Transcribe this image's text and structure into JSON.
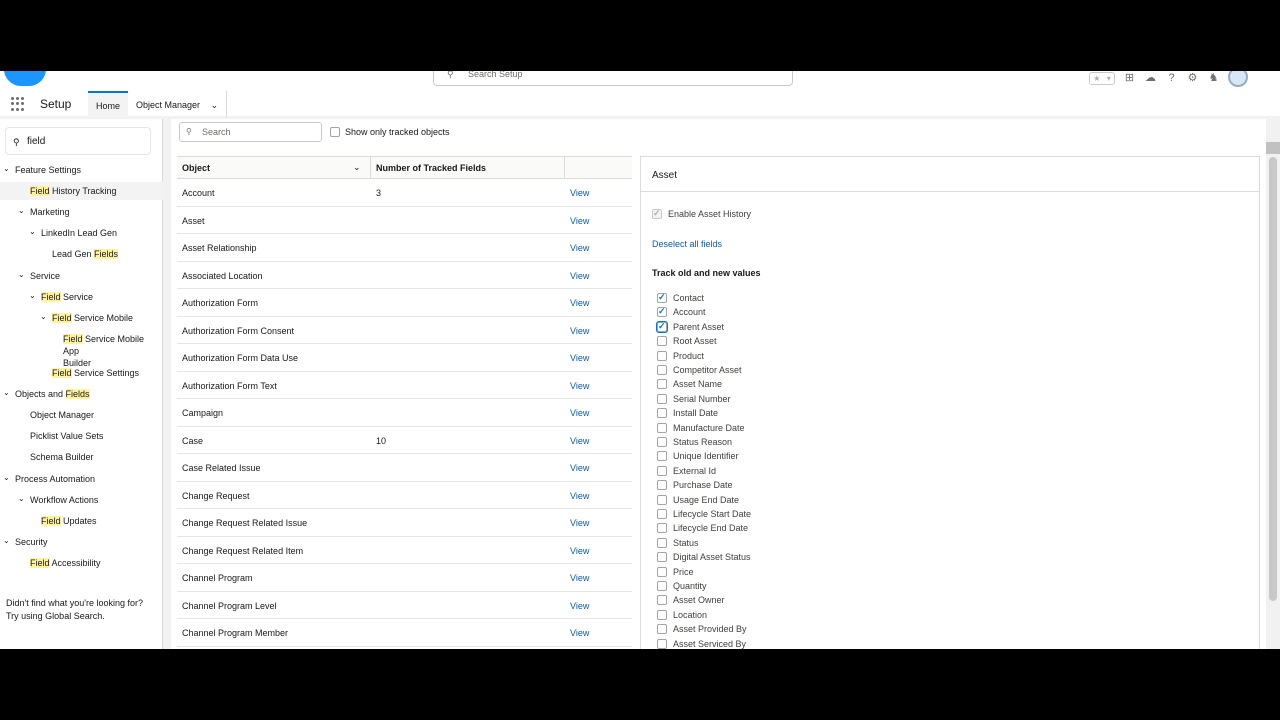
{
  "header": {
    "search_placeholder": "Search Setup",
    "icons": [
      "favorites-star-icon",
      "global-actions-plus-icon",
      "trailhead-icon",
      "help-icon",
      "gear-icon",
      "notifications-bell-icon",
      "user-avatar"
    ]
  },
  "nav": {
    "app_name": "Setup",
    "tabs": [
      {
        "label": "Home",
        "active": true
      },
      {
        "label": "Object Manager",
        "active": false
      }
    ]
  },
  "sidebar": {
    "quickfind_value": "field",
    "items": [
      {
        "pre": "",
        "hl": "",
        "post": "Feature Settings",
        "level": 0,
        "chev": "⌄"
      },
      {
        "pre": "",
        "hl": "Field",
        "post": " History Tracking",
        "level": 1,
        "chev": "",
        "selected": true
      },
      {
        "pre": "",
        "hl": "",
        "post": "Marketing",
        "level": 1,
        "chev": "⌄"
      },
      {
        "pre": "",
        "hl": "",
        "post": "LinkedIn Lead Gen",
        "level": 2,
        "chev": "⌄"
      },
      {
        "pre": "Lead Gen ",
        "hl": "Fields",
        "post": "",
        "level": 3,
        "chev": ""
      },
      {
        "pre": "",
        "hl": "",
        "post": "Service",
        "level": 1,
        "chev": "⌄"
      },
      {
        "pre": "",
        "hl": "Field",
        "post": " Service",
        "level": 2,
        "chev": "⌄"
      },
      {
        "pre": "",
        "hl": "Field",
        "post": " Service Mobile",
        "level": 3,
        "chev": "⌄"
      },
      {
        "pre": "",
        "hl": "Field",
        "post": " Service Mobile App",
        "post2": "Builder",
        "level": 4,
        "chev": ""
      },
      {
        "pre": "",
        "hl": "Field",
        "post": " Service Settings",
        "level": 3,
        "chev": ""
      },
      {
        "pre": "Objects and ",
        "hl": "Fields",
        "post": "",
        "level": 0,
        "chev": "⌄"
      },
      {
        "pre": "",
        "hl": "",
        "post": "Object Manager",
        "level": 1,
        "chev": ""
      },
      {
        "pre": "",
        "hl": "",
        "post": "Picklist Value Sets",
        "level": 1,
        "chev": ""
      },
      {
        "pre": "",
        "hl": "",
        "post": "Schema Builder",
        "level": 1,
        "chev": ""
      },
      {
        "pre": "",
        "hl": "",
        "post": "Process Automation",
        "level": 0,
        "chev": "⌄"
      },
      {
        "pre": "",
        "hl": "",
        "post": "Workflow Actions",
        "level": 1,
        "chev": "⌄"
      },
      {
        "pre": "",
        "hl": "Field",
        "post": " Updates",
        "level": 2,
        "chev": ""
      },
      {
        "pre": "",
        "hl": "",
        "post": "Security",
        "level": 0,
        "chev": "⌄"
      },
      {
        "pre": "",
        "hl": "Field",
        "post": " Accessibility",
        "level": 1,
        "chev": ""
      }
    ],
    "help_line1": "Didn't find what you're looking for?",
    "help_line2": "Try using Global Search."
  },
  "objects": {
    "search_placeholder": "Search",
    "show_tracked_label": "Show only tracked objects",
    "col_object": "Object",
    "col_tracked": "Number of Tracked Fields",
    "view_label": "View",
    "rows": [
      {
        "name": "Account",
        "count": "3"
      },
      {
        "name": "Asset",
        "count": ""
      },
      {
        "name": "Asset Relationship",
        "count": ""
      },
      {
        "name": "Associated Location",
        "count": ""
      },
      {
        "name": "Authorization Form",
        "count": ""
      },
      {
        "name": "Authorization Form Consent",
        "count": ""
      },
      {
        "name": "Authorization Form Data Use",
        "count": ""
      },
      {
        "name": "Authorization Form Text",
        "count": ""
      },
      {
        "name": "Campaign",
        "count": ""
      },
      {
        "name": "Case",
        "count": "10"
      },
      {
        "name": "Case Related Issue",
        "count": ""
      },
      {
        "name": "Change Request",
        "count": ""
      },
      {
        "name": "Change Request Related Issue",
        "count": ""
      },
      {
        "name": "Change Request Related Item",
        "count": ""
      },
      {
        "name": "Channel Program",
        "count": ""
      },
      {
        "name": "Channel Program Level",
        "count": ""
      },
      {
        "name": "Channel Program Member",
        "count": ""
      }
    ]
  },
  "detail": {
    "title": "Asset",
    "enable_label": "Enable Asset History",
    "deselect_label": "Deselect all fields",
    "track_heading": "Track old and new values",
    "fields": [
      {
        "label": "Contact",
        "checked": true
      },
      {
        "label": "Account",
        "checked": true
      },
      {
        "label": "Parent Asset",
        "checked": true,
        "focus": true
      },
      {
        "label": "Root Asset",
        "checked": false
      },
      {
        "label": "Product",
        "checked": false
      },
      {
        "label": "Competitor Asset",
        "checked": false
      },
      {
        "label": "Asset Name",
        "checked": false
      },
      {
        "label": "Serial Number",
        "checked": false
      },
      {
        "label": "Install Date",
        "checked": false
      },
      {
        "label": "Manufacture Date",
        "checked": false
      },
      {
        "label": "Status Reason",
        "checked": false
      },
      {
        "label": "Unique Identifier",
        "checked": false
      },
      {
        "label": "External Id",
        "checked": false
      },
      {
        "label": "Purchase Date",
        "checked": false
      },
      {
        "label": "Usage End Date",
        "checked": false
      },
      {
        "label": "Lifecycle Start Date",
        "checked": false
      },
      {
        "label": "Lifecycle End Date",
        "checked": false
      },
      {
        "label": "Status",
        "checked": false
      },
      {
        "label": "Digital Asset Status",
        "checked": false
      },
      {
        "label": "Price",
        "checked": false
      },
      {
        "label": "Quantity",
        "checked": false
      },
      {
        "label": "Asset Owner",
        "checked": false
      },
      {
        "label": "Location",
        "checked": false
      },
      {
        "label": "Asset Provided By",
        "checked": false
      },
      {
        "label": "Asset Serviced By",
        "checked": false
      }
    ]
  }
}
